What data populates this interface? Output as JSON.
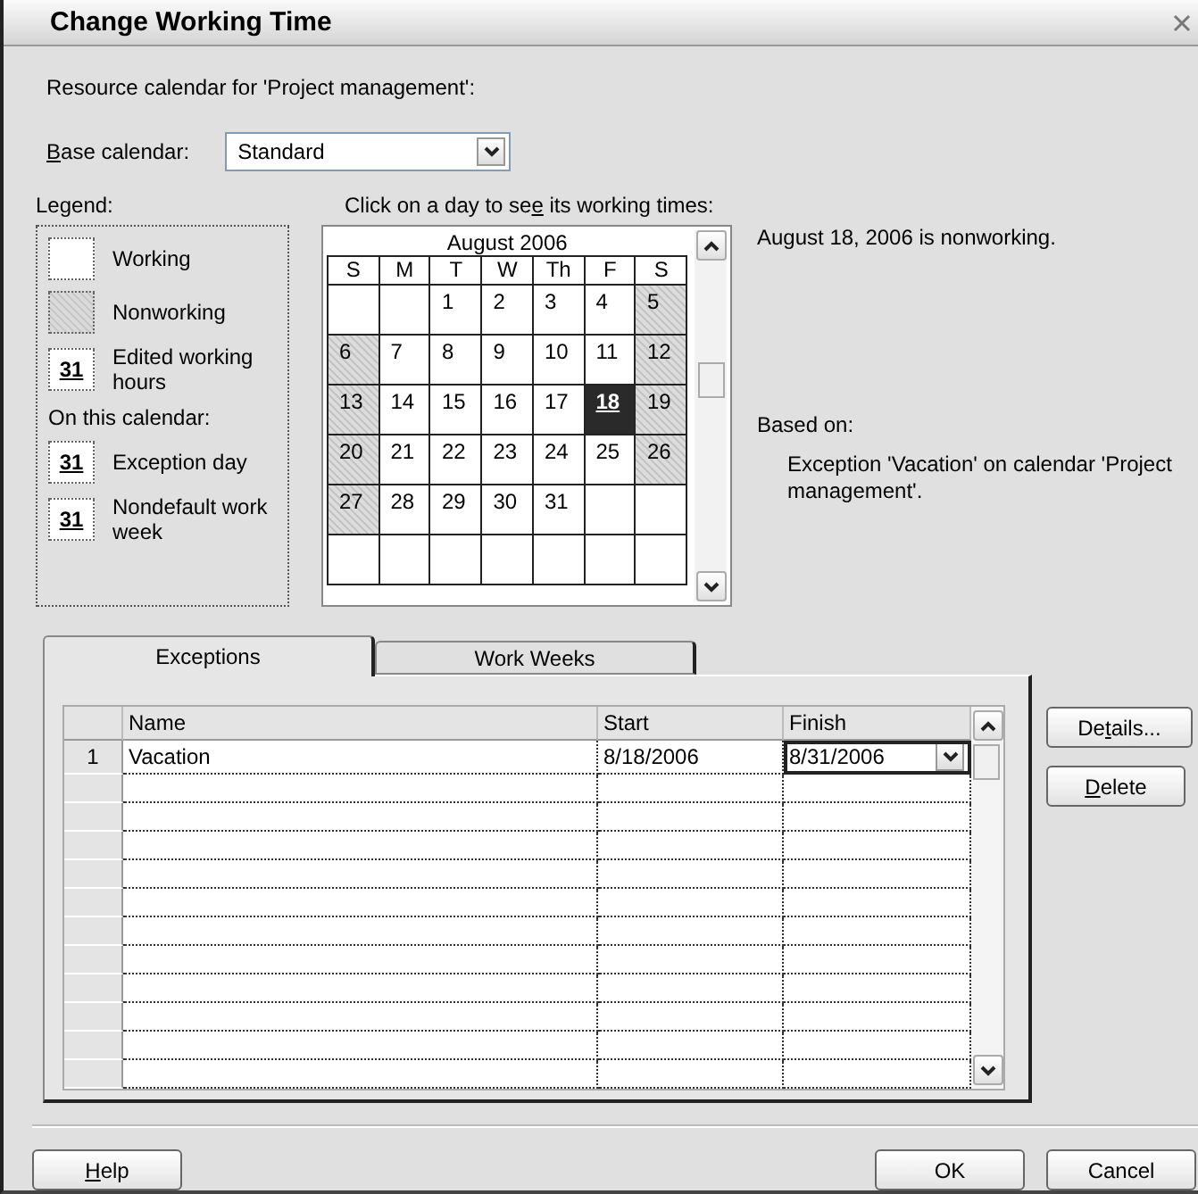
{
  "window": {
    "title": "Change Working Time"
  },
  "resource_label": "Resource calendar for 'Project management':",
  "base_calendar": {
    "label": "Base calendar:",
    "value": "Standard"
  },
  "legend": {
    "title": "Legend:",
    "items": [
      {
        "kind": "working",
        "label": "Working"
      },
      {
        "kind": "nonworking",
        "label": "Nonworking"
      },
      {
        "kind": "edited",
        "swatch_text": "31",
        "label": "Edited working hours"
      },
      {
        "kind": "heading",
        "label": "On this calendar:"
      },
      {
        "kind": "exception",
        "swatch_text": "31",
        "label": "Exception day"
      },
      {
        "kind": "nondefault",
        "swatch_text": "31",
        "label": "Nondefault work week"
      }
    ]
  },
  "calendar": {
    "prompt": "Click on a day to see its working times:",
    "month": "August 2006",
    "weekdays": [
      "S",
      "M",
      "T",
      "W",
      "Th",
      "F",
      "S"
    ],
    "weeks": [
      [
        {
          "nonworking": false,
          "selected": false
        },
        {
          "nonworking": false,
          "selected": false
        },
        {
          "day": "1",
          "nonworking": false,
          "selected": false
        },
        {
          "day": "2",
          "nonworking": false,
          "selected": false
        },
        {
          "day": "3",
          "nonworking": false,
          "selected": false
        },
        {
          "day": "4",
          "nonworking": false,
          "selected": false
        },
        {
          "day": "5",
          "nonworking": true,
          "selected": false
        }
      ],
      [
        {
          "day": "6",
          "nonworking": true,
          "selected": false
        },
        {
          "day": "7",
          "nonworking": false,
          "selected": false
        },
        {
          "day": "8",
          "nonworking": false,
          "selected": false
        },
        {
          "day": "9",
          "nonworking": false,
          "selected": false
        },
        {
          "day": "10",
          "nonworking": false,
          "selected": false
        },
        {
          "day": "11",
          "nonworking": false,
          "selected": false
        },
        {
          "day": "12",
          "nonworking": true,
          "selected": false
        }
      ],
      [
        {
          "day": "13",
          "nonworking": true,
          "selected": false
        },
        {
          "day": "14",
          "nonworking": false,
          "selected": false
        },
        {
          "day": "15",
          "nonworking": false,
          "selected": false
        },
        {
          "day": "16",
          "nonworking": false,
          "selected": false
        },
        {
          "day": "17",
          "nonworking": false,
          "selected": false
        },
        {
          "day": "18",
          "nonworking": true,
          "selected": true
        },
        {
          "day": "19",
          "nonworking": true,
          "selected": false
        }
      ],
      [
        {
          "day": "20",
          "nonworking": true,
          "selected": false
        },
        {
          "day": "21",
          "nonworking": false,
          "selected": false
        },
        {
          "day": "22",
          "nonworking": false,
          "selected": false
        },
        {
          "day": "23",
          "nonworking": false,
          "selected": false
        },
        {
          "day": "24",
          "nonworking": false,
          "selected": false
        },
        {
          "day": "25",
          "nonworking": false,
          "selected": false
        },
        {
          "day": "26",
          "nonworking": true,
          "selected": false
        }
      ],
      [
        {
          "day": "27",
          "nonworking": true,
          "selected": false
        },
        {
          "day": "28",
          "nonworking": false,
          "selected": false
        },
        {
          "day": "29",
          "nonworking": false,
          "selected": false
        },
        {
          "day": "30",
          "nonworking": false,
          "selected": false
        },
        {
          "day": "31",
          "nonworking": false,
          "selected": false
        },
        {
          "nonworking": false,
          "selected": false
        },
        {
          "nonworking": false,
          "selected": false
        }
      ],
      [
        {
          "nonworking": false,
          "selected": false
        },
        {
          "nonworking": false,
          "selected": false
        },
        {
          "nonworking": false,
          "selected": false
        },
        {
          "nonworking": false,
          "selected": false
        },
        {
          "nonworking": false,
          "selected": false
        },
        {
          "nonworking": false,
          "selected": false
        },
        {
          "nonworking": false,
          "selected": false
        }
      ]
    ]
  },
  "day_info": {
    "status": "August 18, 2006 is nonworking.",
    "based_on_label": "Based on:",
    "based_on": "Exception 'Vacation' on calendar 'Project management'."
  },
  "tabs": [
    {
      "label": "Exceptions",
      "selected": true
    },
    {
      "label": "Work Weeks",
      "selected": false
    }
  ],
  "table": {
    "columns": [
      "Name",
      "Start",
      "Finish"
    ],
    "rows": [
      {
        "id": "1",
        "name": "Vacation",
        "start": "8/18/2006",
        "finish": "8/31/2006",
        "editing": true
      }
    ]
  },
  "side_buttons": [
    {
      "label": "Details..."
    },
    {
      "label": "Delete"
    }
  ],
  "footer_left_buttons": [
    {
      "label": "Help"
    }
  ],
  "footer_right_buttons": [
    {
      "label": "OK"
    },
    {
      "label": "Cancel"
    }
  ]
}
